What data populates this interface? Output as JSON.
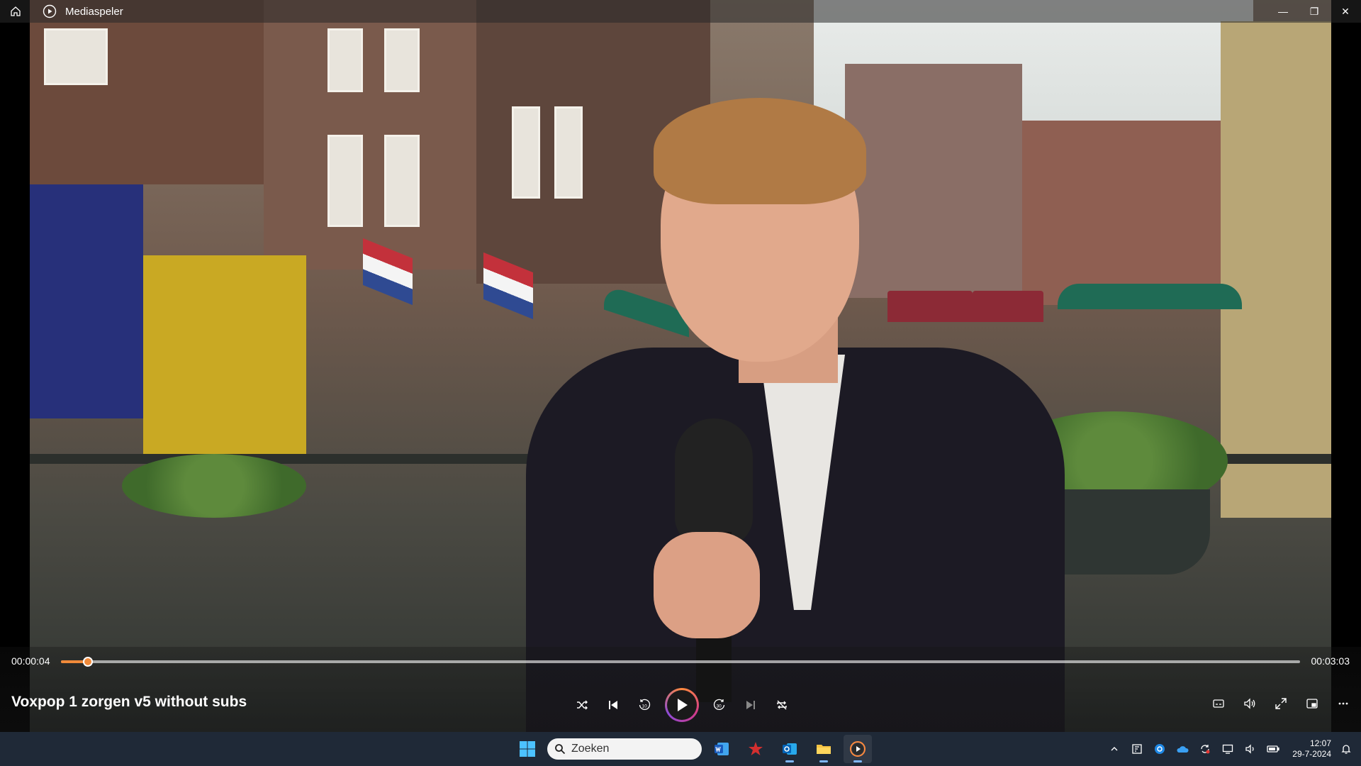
{
  "window": {
    "title": "Mediaspeler",
    "minimize_symbol": "—",
    "restore_symbol": "❐",
    "close_symbol": "✕"
  },
  "player": {
    "current_time": "00:00:04",
    "duration": "00:03:03",
    "progress_fraction": 0.022,
    "media_title": "Voxpop 1 zorgen v5 without subs",
    "accent_color": "#f08a3a"
  },
  "taskbar": {
    "search_placeholder": "Zoeken",
    "time": "12:07",
    "date": "29-7-2024"
  },
  "icons": {
    "controls": [
      "shuffle-icon",
      "previous-icon",
      "rewind-10-icon",
      "play-icon",
      "forward-30-icon",
      "next-icon",
      "repeat-icon"
    ],
    "right_controls": [
      "subtitles-icon",
      "volume-icon",
      "fullscreen-icon",
      "miniplayer-icon",
      "more-icon"
    ],
    "taskbar_apps": [
      "windows-start-icon",
      "search-icon",
      "word-icon",
      "app-red-icon",
      "outlook-icon",
      "file-explorer-icon",
      "media-player-icon"
    ],
    "tray": [
      "chevron-up-icon",
      "tray-app-icon",
      "tray-app-blue-icon",
      "onedrive-icon",
      "sync-icon",
      "display-icon",
      "speaker-icon",
      "battery-icon",
      "notification-icon"
    ]
  }
}
